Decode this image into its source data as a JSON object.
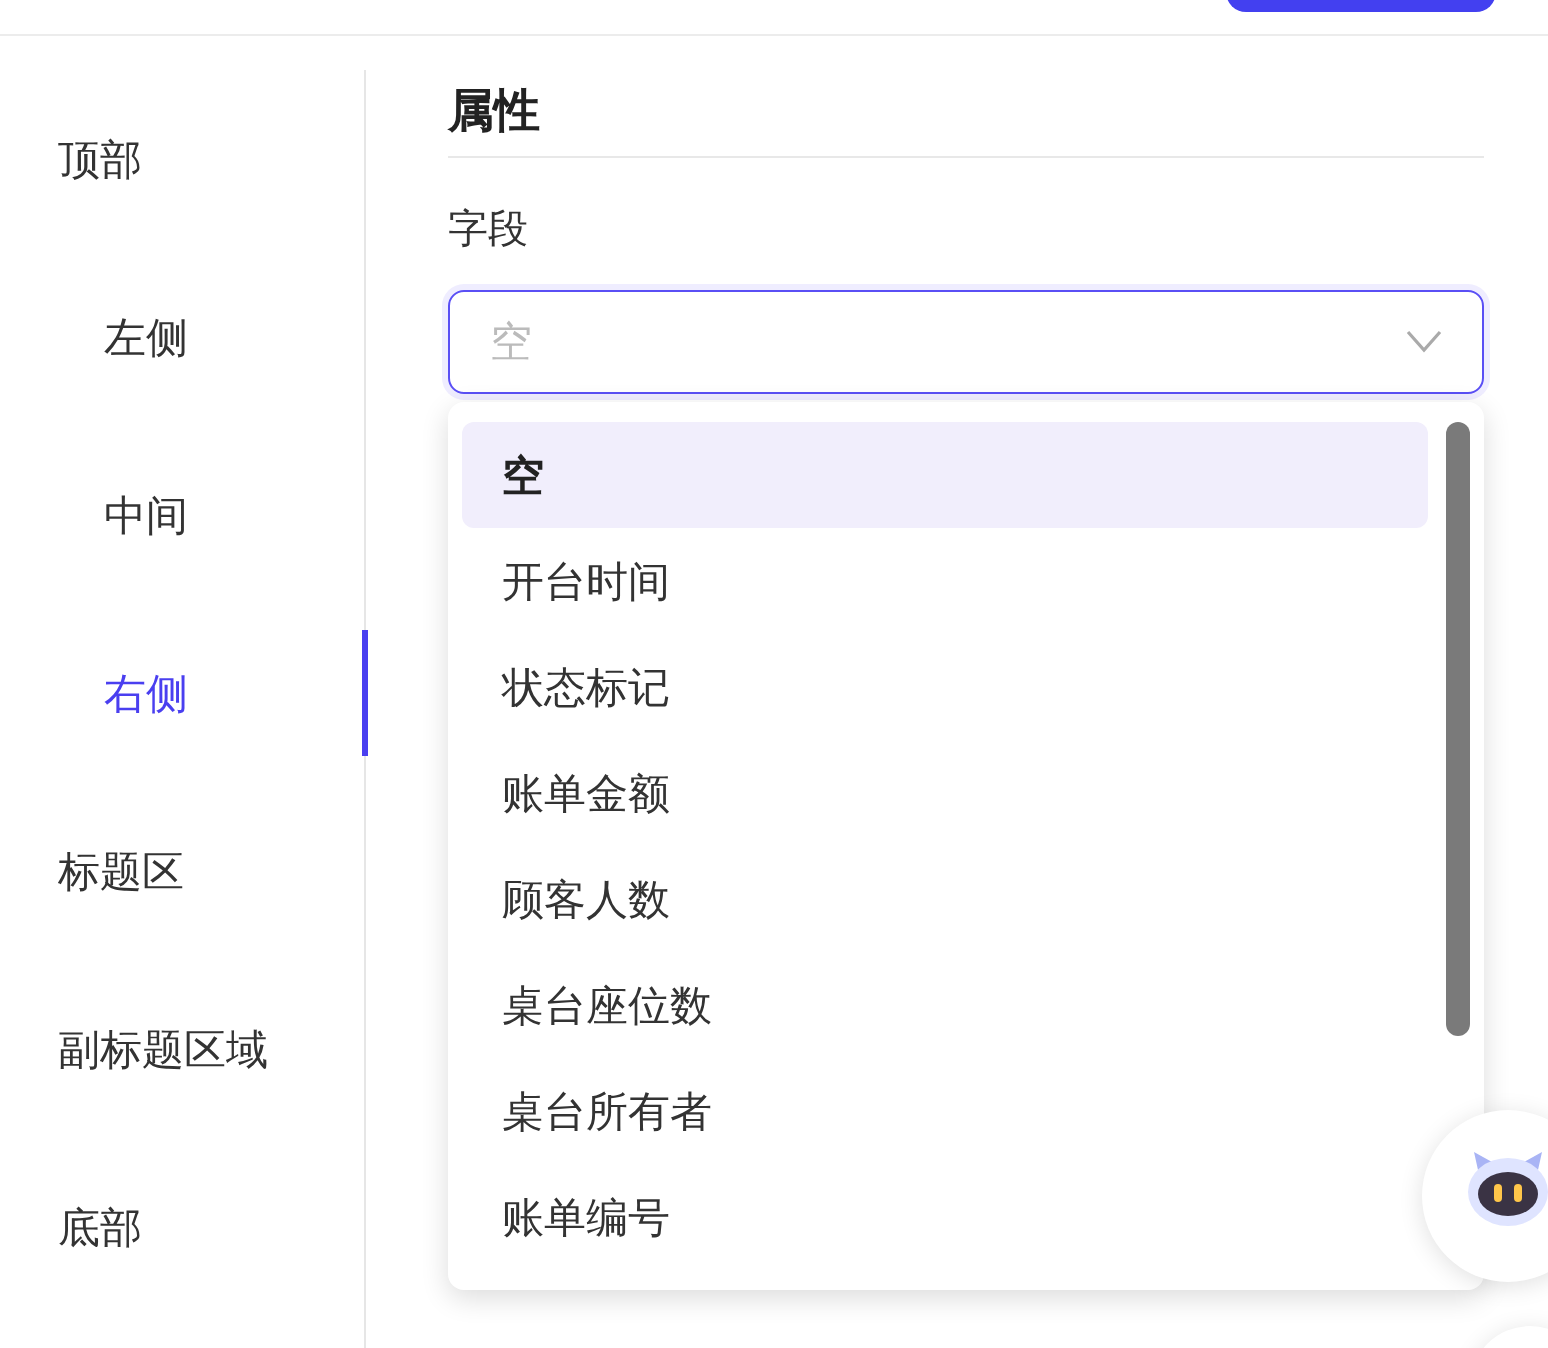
{
  "nav": [
    {
      "label": "顶部",
      "selected": false,
      "children": [
        {
          "label": "左侧",
          "selected": false
        },
        {
          "label": "中间",
          "selected": false
        },
        {
          "label": "右侧",
          "selected": true
        }
      ]
    },
    {
      "label": "标题区",
      "selected": false
    },
    {
      "label": "副标题区域",
      "selected": false
    },
    {
      "label": "底部",
      "selected": false
    }
  ],
  "panel": {
    "title": "属性",
    "field_label": "字段",
    "select": {
      "placeholder": "空",
      "expanded": true
    },
    "options": [
      {
        "label": "空",
        "selected": true
      },
      {
        "label": "开台时间",
        "selected": false
      },
      {
        "label": "状态标记",
        "selected": false
      },
      {
        "label": "账单金额",
        "selected": false
      },
      {
        "label": "顾客人数",
        "selected": false
      },
      {
        "label": "桌台座位数",
        "selected": false
      },
      {
        "label": "桌台所有者",
        "selected": false
      },
      {
        "label": "账单编号",
        "selected": false
      }
    ]
  }
}
